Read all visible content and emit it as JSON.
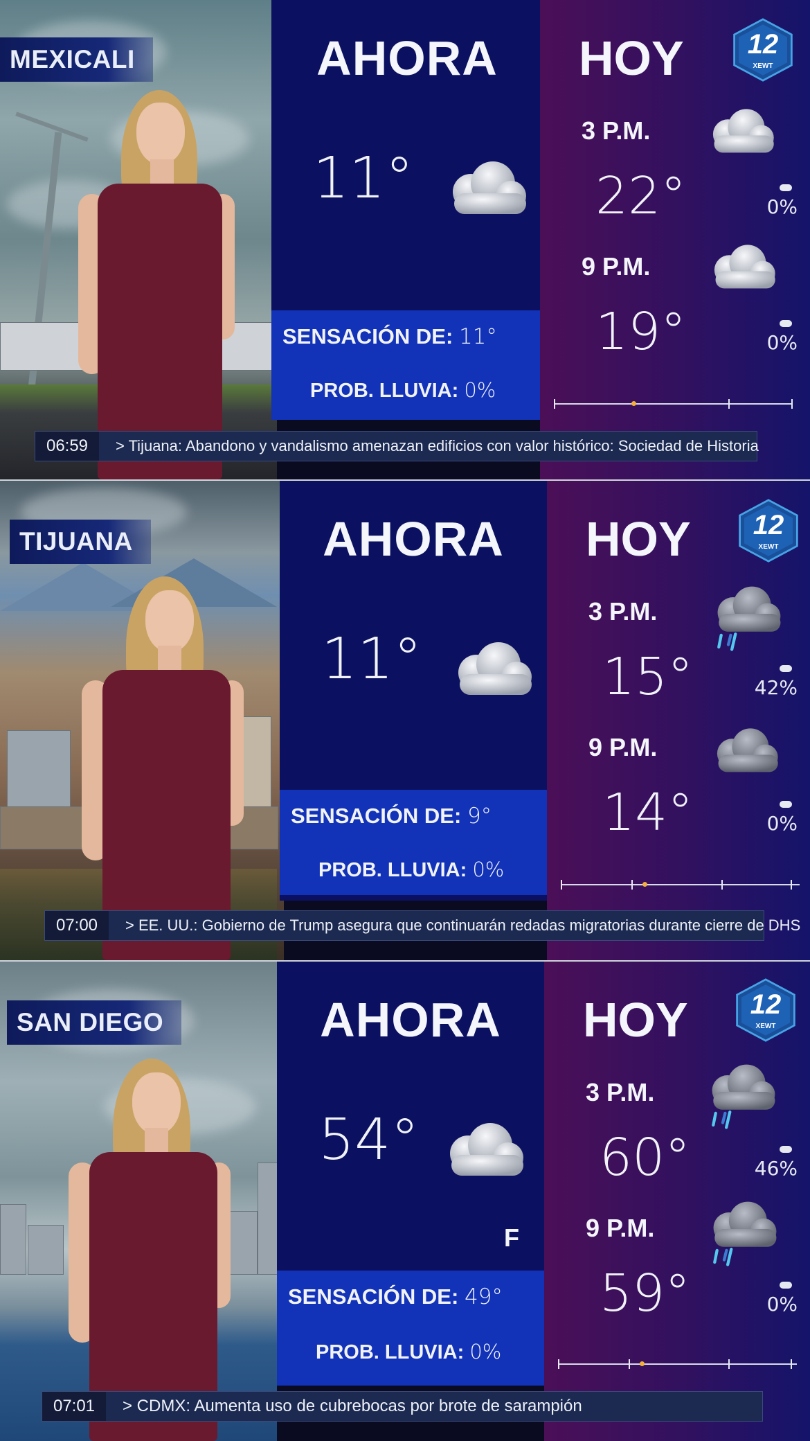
{
  "panels": [
    {
      "city": "MEXICALI",
      "ahora": {
        "title": "AHORA",
        "temp": "11°",
        "icon": "cloud-icon",
        "unit": "",
        "feels_label": "SENSACIÓN DE:",
        "feels_value": "11°",
        "rain_label": "PROB. LLUVIA:",
        "rain_value": "0%"
      },
      "hoy": {
        "title": "HOY",
        "slots": [
          {
            "time": "3 P.M.",
            "temp": "22°",
            "rain": "0%",
            "icon": "cloud-icon"
          },
          {
            "time": "9 P.M.",
            "temp": "19°",
            "rain": "0%",
            "icon": "cloud-icon"
          }
        ]
      },
      "ticker": {
        "clock": "06:59",
        "text": "> Tijuana: Abandono y vandalismo amenazan edificios con valor histórico: Sociedad de Historia"
      },
      "logo": {
        "number": "12",
        "sub": "XEWT"
      }
    },
    {
      "city": "TIJUANA",
      "ahora": {
        "title": "AHORA",
        "temp": "11°",
        "icon": "cloud-icon",
        "unit": "",
        "feels_label": "SENSACIÓN DE:",
        "feels_value": "9°",
        "rain_label": "PROB. LLUVIA:",
        "rain_value": "0%"
      },
      "hoy": {
        "title": "HOY",
        "slots": [
          {
            "time": "3 P.M.",
            "temp": "15°",
            "rain": "42%",
            "icon": "rain-cloud-icon"
          },
          {
            "time": "9 P.M.",
            "temp": "14°",
            "rain": "0%",
            "icon": "dark-cloud-icon"
          }
        ]
      },
      "ticker": {
        "clock": "07:00",
        "text": "> EE. UU.: Gobierno de Trump asegura que continuarán redadas migratorias durante cierre de DHS"
      },
      "logo": {
        "number": "12",
        "sub": "XEWT"
      }
    },
    {
      "city": "SAN DIEGO",
      "ahora": {
        "title": "AHORA",
        "temp": "54°",
        "icon": "cloud-icon",
        "unit": "F",
        "feels_label": "SENSACIÓN DE:",
        "feels_value": "49°",
        "rain_label": "PROB. LLUVIA:",
        "rain_value": "0%"
      },
      "hoy": {
        "title": "HOY",
        "slots": [
          {
            "time": "3 P.M.",
            "temp": "60°",
            "rain": "46%",
            "icon": "rain-cloud-icon"
          },
          {
            "time": "9 P.M.",
            "temp": "59°",
            "rain": "0%",
            "icon": "rain-cloud-icon"
          }
        ]
      },
      "ticker": {
        "clock": "07:01",
        "text": "> CDMX: Aumenta uso de cubrebocas por brote de sarampión"
      },
      "logo": {
        "number": "12",
        "sub": "XEWT"
      }
    }
  ],
  "colors": {
    "ahora_bg": "#0b1160",
    "feels_box": "#1233b8",
    "hoy_bg": "#301160",
    "accent_red": "#d2323a",
    "timeline_marker": "#f2b13a"
  }
}
